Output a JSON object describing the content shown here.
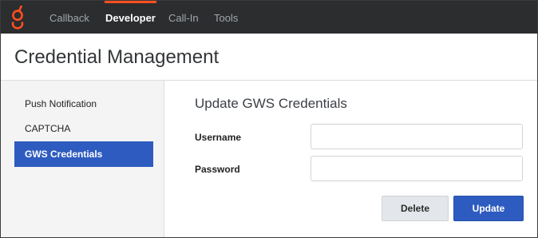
{
  "nav": {
    "logo_icon": "genesys-logo-icon",
    "brand_color": "#ff4f1f",
    "tabs": [
      {
        "label": "Callback",
        "active": false
      },
      {
        "label": "Developer",
        "active": true
      },
      {
        "label": "Call-In",
        "active": false
      },
      {
        "label": "Tools",
        "active": false
      }
    ]
  },
  "page": {
    "title": "Credential Management"
  },
  "sidebar": {
    "items": [
      {
        "label": "Push Notification",
        "active": false
      },
      {
        "label": "CAPTCHA",
        "active": false
      },
      {
        "label": "GWS Credentials",
        "active": true
      }
    ],
    "active_color": "#2e5bbf"
  },
  "form": {
    "title": "Update GWS Credentials",
    "username_label": "Username",
    "username_value": "",
    "password_label": "Password",
    "password_value": "",
    "delete_label": "Delete",
    "update_label": "Update"
  }
}
